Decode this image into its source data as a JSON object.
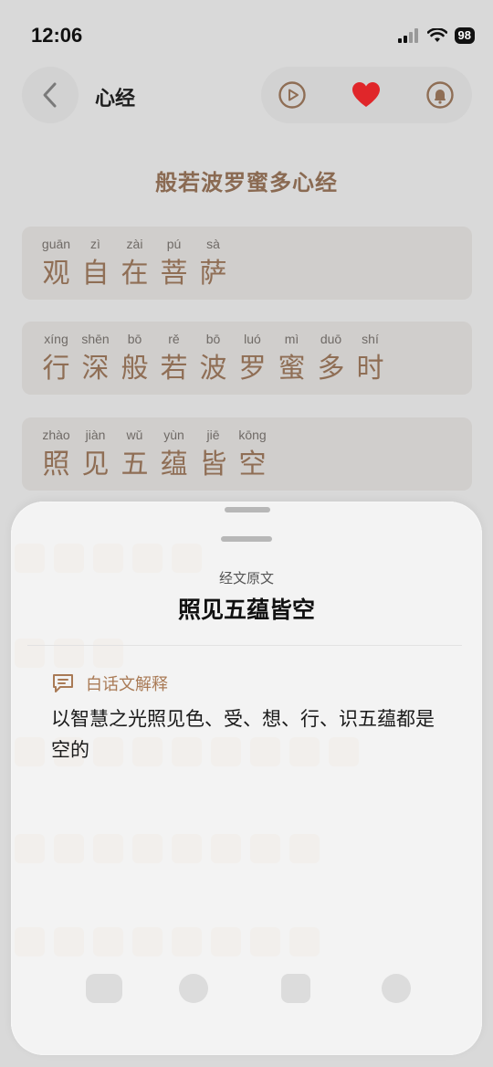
{
  "status_bar": {
    "time": "12:06",
    "battery": "98"
  },
  "nav": {
    "title": "心经"
  },
  "page_title": "般若波罗蜜多心经",
  "verses": [
    {
      "syllables": [
        {
          "pinyin": "guān",
          "hanzi": "观"
        },
        {
          "pinyin": "zì",
          "hanzi": "自"
        },
        {
          "pinyin": "zài",
          "hanzi": "在"
        },
        {
          "pinyin": "pú",
          "hanzi": "菩"
        },
        {
          "pinyin": "sà",
          "hanzi": "萨"
        }
      ]
    },
    {
      "syllables": [
        {
          "pinyin": "xíng",
          "hanzi": "行"
        },
        {
          "pinyin": "shēn",
          "hanzi": "深"
        },
        {
          "pinyin": "bō",
          "hanzi": "般"
        },
        {
          "pinyin": "rě",
          "hanzi": "若"
        },
        {
          "pinyin": "bō",
          "hanzi": "波"
        },
        {
          "pinyin": "luó",
          "hanzi": "罗"
        },
        {
          "pinyin": "mì",
          "hanzi": "蜜"
        },
        {
          "pinyin": "duō",
          "hanzi": "多"
        },
        {
          "pinyin": "shí",
          "hanzi": "时"
        }
      ]
    },
    {
      "syllables": [
        {
          "pinyin": "zhào",
          "hanzi": "照"
        },
        {
          "pinyin": "jiàn",
          "hanzi": "见"
        },
        {
          "pinyin": "wǔ",
          "hanzi": "五"
        },
        {
          "pinyin": "yùn",
          "hanzi": "蕴"
        },
        {
          "pinyin": "jiē",
          "hanzi": "皆"
        },
        {
          "pinyin": "kōng",
          "hanzi": "空"
        }
      ]
    }
  ],
  "sheet": {
    "subtitle": "经文原文",
    "title": "照见五蕴皆空",
    "explain_label": "白话文解释",
    "explain_text": "以智慧之光照见色、受、想、行、识五蕴都是空的"
  },
  "colors": {
    "accent": "#8f6e55",
    "heart": "#e0262a",
    "explain_label": "#a97a55"
  },
  "icons": [
    "chevron-left-icon",
    "play-icon",
    "heart-icon",
    "bell-icon",
    "chat-bubble-icon",
    "wifi-icon",
    "signal-icon"
  ]
}
